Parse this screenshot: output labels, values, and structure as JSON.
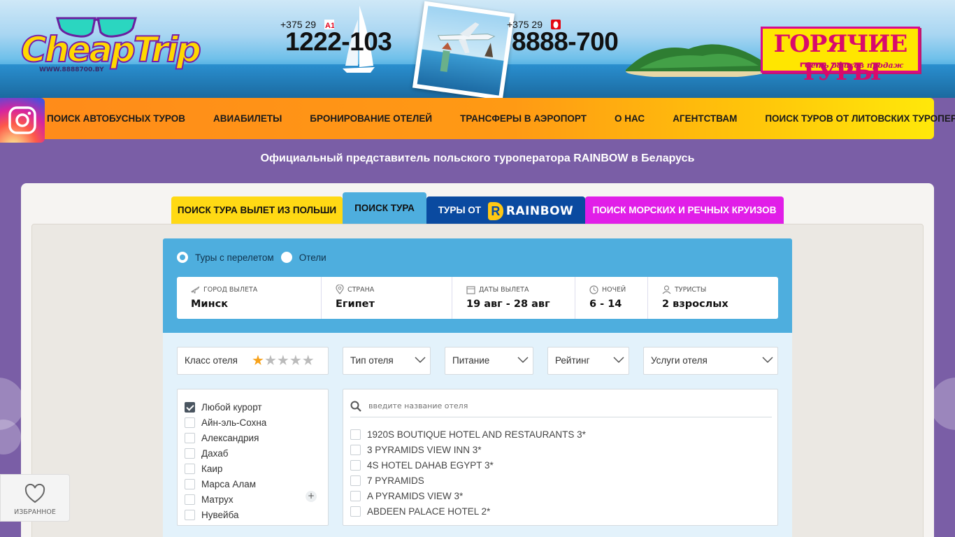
{
  "header": {
    "logo_text": "CheapTrip",
    "logo_url": "WWW.8888700.BY",
    "phone1": {
      "code": "+375 29",
      "number": "1222-103",
      "operator": "A1"
    },
    "phone2": {
      "code": "+375 29",
      "number": "8888-700",
      "operator": "MTS"
    },
    "hot_tours": {
      "title": "ГОРЯЧИЕ ТУРЫ",
      "subtitle": "Сеть офисов продаж"
    }
  },
  "nav": {
    "items": [
      "ПОИСК АВТОБУСНЫХ ТУРОВ",
      "АВИАБИЛЕТЫ",
      "БРОНИРОВАНИЕ ОТЕЛЕЙ",
      "ТРАНСФЕРЫ В АЭРОПОРТ",
      "О НАС",
      "АГЕНТСТВАМ",
      "ПОИСК ТУРОВ ОТ ЛИТОВСКИХ ТУРОПЕРАТОРОВ"
    ]
  },
  "tagline": "Официальный представитель польского туроператора RAINBOW в Беларусь",
  "tabs": {
    "poland": "ПОИСК ТУРА ВЫЛЕТ ИЗ ПОЛЬШИ",
    "search": "ПОИСК ТУРА",
    "rainbow_prefix": "ТУРЫ ОТ",
    "rainbow_word": "RAINBOW",
    "cruise": "ПОИСК МОРСКИХ И РЕЧНЫХ КРУИЗОВ"
  },
  "search_type": {
    "option1": "Туры с перелетом",
    "option2": "Отели",
    "selected": "Туры с перелетом"
  },
  "fields": {
    "departure": {
      "label": "ГОРОД ВЫЛЕТА",
      "value": "Минск"
    },
    "country": {
      "label": "СТРАНА",
      "value": "Египет"
    },
    "dates": {
      "label": "ДАТЫ ВЫЛЕТА",
      "value": "19 авг - 28 авг"
    },
    "nights": {
      "label": "НОЧЕЙ",
      "value": "6 - 14"
    },
    "tourists": {
      "label": "ТУРИСТЫ",
      "value": "2 взрослых"
    }
  },
  "filters": {
    "hotel_class": "Класс отеля",
    "hotel_class_stars": 1,
    "hotel_class_max": 5,
    "hotel_type": "Тип отеля",
    "meal": "Питание",
    "rating": "Рейтинг",
    "services": "Услуги отеля"
  },
  "resorts": [
    {
      "name": "Любой курорт",
      "checked": true
    },
    {
      "name": "Айн-эль-Сохна",
      "checked": false
    },
    {
      "name": "Александрия",
      "checked": false
    },
    {
      "name": "Дахаб",
      "checked": false
    },
    {
      "name": "Каир",
      "checked": false
    },
    {
      "name": "Марса Алам",
      "checked": false
    },
    {
      "name": "Матрух",
      "checked": false
    },
    {
      "name": "Нувейба",
      "checked": false
    }
  ],
  "hotel_search": {
    "placeholder": "введите название отеля",
    "hotels": [
      "1920S BOUTIQUE HOTEL AND RESTAURANTS 3*",
      "3 PYRAMIDS VIEW INN 3*",
      "4S HOTEL DAHAB EGYPT 3*",
      "7 PYRAMIDS",
      "A PYRAMIDS VIEW 3*",
      "ABDEEN PALACE HOTEL 2*"
    ]
  },
  "favorites": {
    "label": "ИЗБРАННОЕ"
  },
  "colors": {
    "background": "#7a5ea6",
    "accent_blue": "#4eaede",
    "nav_orange": "#ff8a1a",
    "nav_yellow": "#ffe80a",
    "cruise_magenta": "#e11ee8",
    "rainbow_blue": "#0a4aa0"
  }
}
